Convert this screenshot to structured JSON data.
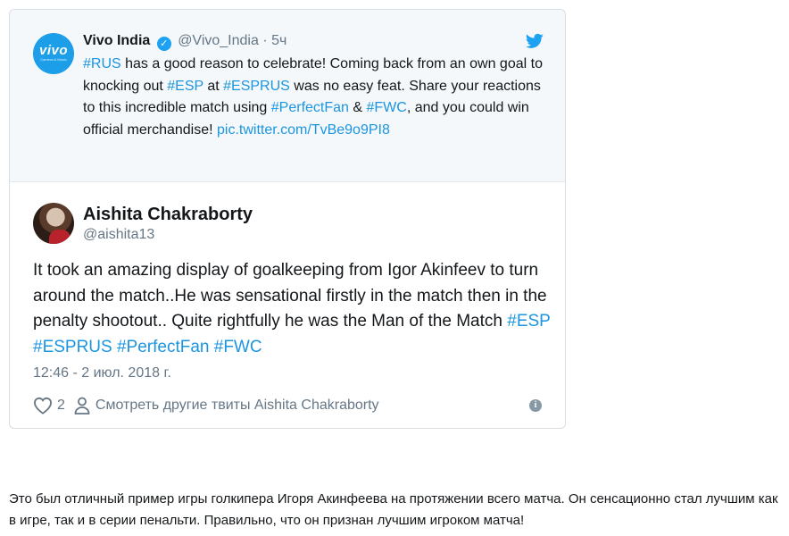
{
  "quoted_tweet": {
    "logo_text": "vivo",
    "logo_subtext": "Camera & Music",
    "name": "Vivo India",
    "handle": "@Vivo_India",
    "separator": "·",
    "time": "5ч",
    "text_parts": [
      {
        "hashtag": "#RUS"
      },
      {
        "text": " has a good reason to celebrate! Coming back from an own goal to knocking out "
      },
      {
        "hashtag": "#ESP"
      },
      {
        "text": " at "
      },
      {
        "hashtag": "#ESPRUS"
      },
      {
        "text": " was no easy feat. Share your reactions to this incredible match using "
      },
      {
        "hashtag": "#PerfectFan"
      },
      {
        "text": " & "
      },
      {
        "hashtag": "#FWC"
      },
      {
        "text": ", and you could win official merchandise! "
      },
      {
        "link": "pic.twitter.com/TvBe9o9PI8"
      }
    ]
  },
  "main_tweet": {
    "name": "Aishita Chakraborty",
    "handle": "@aishita13",
    "text": "It took an amazing display of goalkeeping from Igor Akinfeev to turn around the match..He was sensational firstly in the match then in the penalty shootout.. Quite rightfully he was the Man of the Match ",
    "hashtags": "#ESP #ESPRUS #PerfectFan #FWC",
    "date": "12:46 - 2 июл. 2018 г.",
    "like_count": "2",
    "more_tweets_label": "Смотреть другие твиты Aishita Chakraborty",
    "info_glyph": "i"
  },
  "caption": "Это был отличный пример игры голкипера Игоря Акинфеева на протяжении всего матча. Он сенсационно стал лучшим как в игре, так и в серии пенальти. Правильно, что он признан лучшим игроком матча!",
  "colors": {
    "accent": "#1b95e0",
    "muted": "#657786",
    "quoted_bg": "#f5f8fa",
    "vivo_blue": "#1c9ee8"
  }
}
